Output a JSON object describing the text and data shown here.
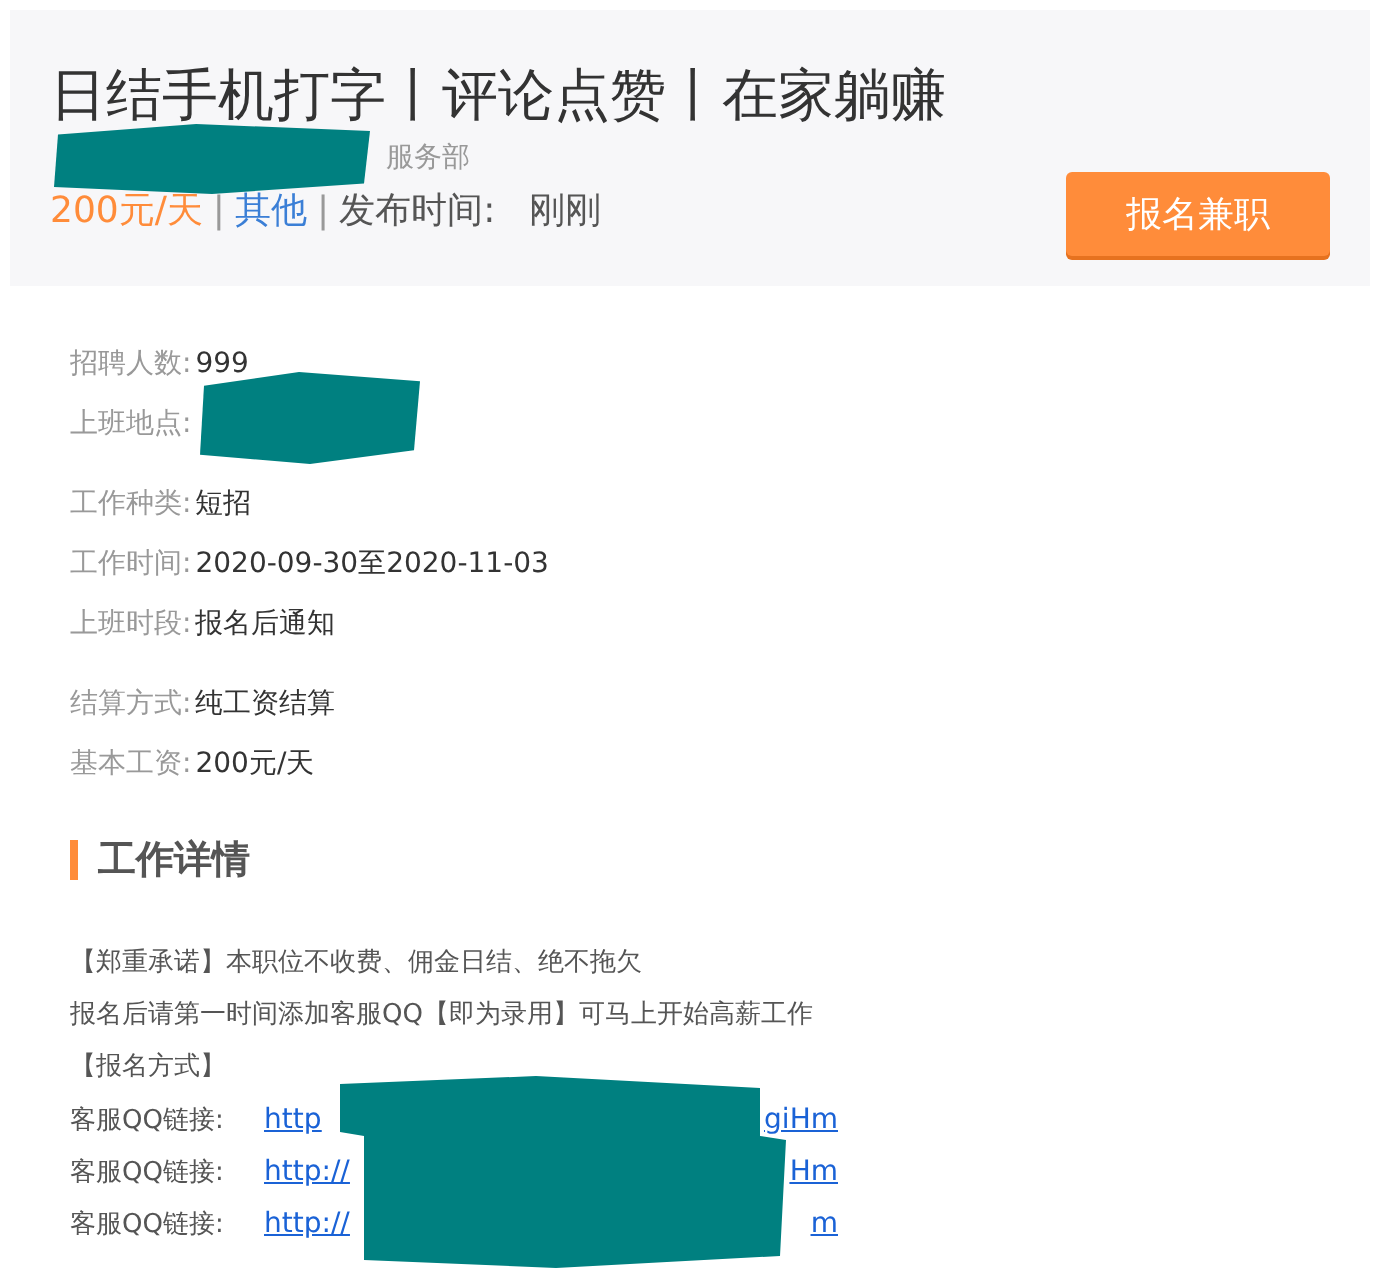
{
  "header": {
    "title": "日结手机打字丨评论点赞丨在家躺赚",
    "company_suffix": "服务部",
    "salary": "200元/天",
    "separator": "|",
    "category": "其他",
    "posted_label": "发布时间:",
    "posted_value": "刚刚",
    "apply_button": "报名兼职"
  },
  "info_groups": [
    [
      {
        "label": "招聘人数:",
        "value": "999"
      },
      {
        "label": "上班地点:",
        "redacted": true
      }
    ],
    [
      {
        "label": "工作种类:",
        "value": "短招"
      },
      {
        "label": "工作时间:",
        "value": "2020-09-30至2020-11-03"
      },
      {
        "label": "上班时段:",
        "value": "报名后通知"
      }
    ],
    [
      {
        "label": "结算方式:",
        "value": "纯工资结算"
      },
      {
        "label": "基本工资:",
        "value": "200元/天"
      }
    ]
  ],
  "section_title": "工作详情",
  "description": [
    "【郑重承诺】本职位不收费、佣金日结、绝不拖欠",
    "报名后请第一时间添加客服QQ【即为录用】可马上开始高薪工作",
    "【报名方式】"
  ],
  "links": [
    {
      "label": "客服QQ链接:",
      "start": "http",
      "end": "giHm"
    },
    {
      "label": "客服QQ链接:",
      "start": "http://",
      "end": "Hm"
    },
    {
      "label": "客服QQ链接:",
      "start": "http://",
      "end": "m"
    }
  ]
}
